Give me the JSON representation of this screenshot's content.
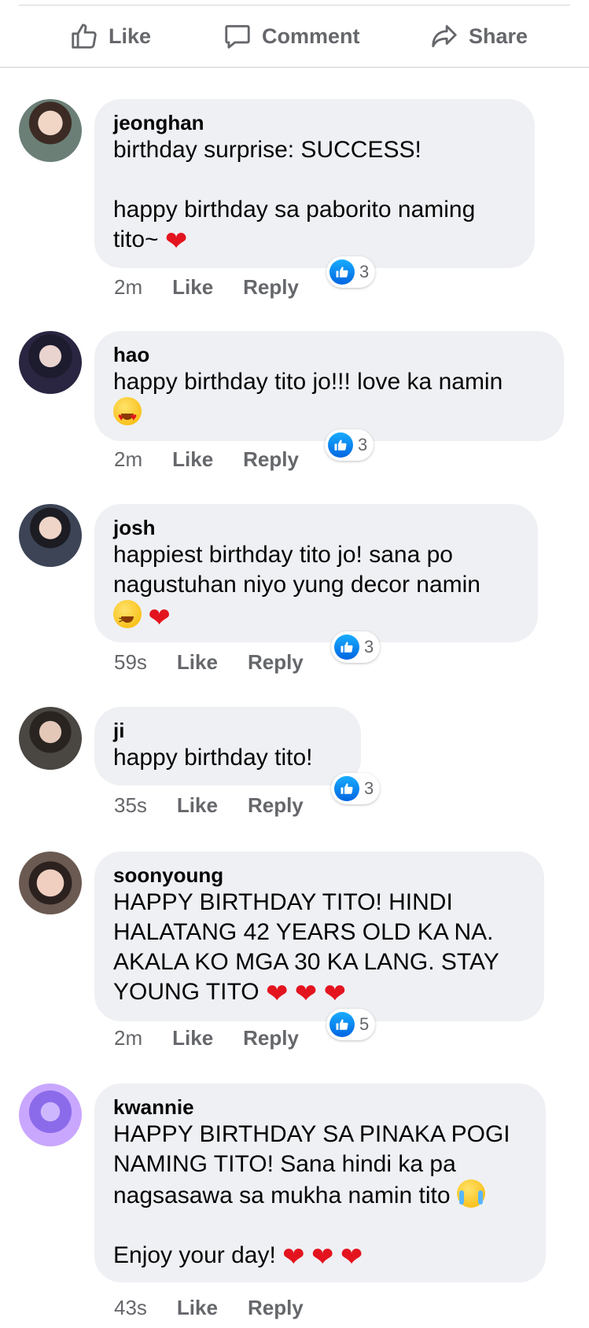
{
  "actions": {
    "like": "Like",
    "comment": "Comment",
    "share": "Share"
  },
  "comments": [
    {
      "author": "jeonghan",
      "line1": "birthday surprise: SUCCESS!",
      "line2": "happy birthday sa paborito naming",
      "line3": "tito~",
      "time": "2m",
      "like": "Like",
      "reply": "Reply",
      "reactions": "3"
    },
    {
      "author": "hao",
      "line1": "happy birthday tito jo!!! love ka namin",
      "time": "2m",
      "like": "Like",
      "reply": "Reply",
      "reactions": "3"
    },
    {
      "author": "josh",
      "line1": "happiest birthday tito jo! sana po",
      "line2": "nagustuhan niyo yung decor namin",
      "time": "59s",
      "like": "Like",
      "reply": "Reply",
      "reactions": "3"
    },
    {
      "author": "ji",
      "line1": "happy birthday tito!",
      "time": "35s",
      "like": "Like",
      "reply": "Reply",
      "reactions": "3"
    },
    {
      "author": "soonyoung",
      "line1": "HAPPY BIRTHDAY TITO! HINDI",
      "line2": "HALATANG 42 YEARS OLD KA NA.",
      "line3": "AKALA KO MGA 30 KA LANG. STAY",
      "line4": "YOUNG TITO",
      "time": "2m",
      "like": "Like",
      "reply": "Reply",
      "reactions": "5"
    },
    {
      "author": "kwannie",
      "line1": "HAPPY BIRTHDAY SA PINAKA POGI",
      "line2": "NAMING TITO! Sana hindi ka pa",
      "line3": "nagsasawa sa mukha namin tito",
      "line4": "Enjoy your day!",
      "time": "43s",
      "like": "Like",
      "reply": "Reply"
    }
  ],
  "colors": {
    "bubble": "#eff0f4",
    "meta": "#65676b",
    "like_blue": "#0165e1",
    "heart": "#e3141e"
  },
  "icons": {
    "like": "thumbs-up-icon",
    "comment": "speech-bubble-icon",
    "share": "share-arrow-icon"
  }
}
